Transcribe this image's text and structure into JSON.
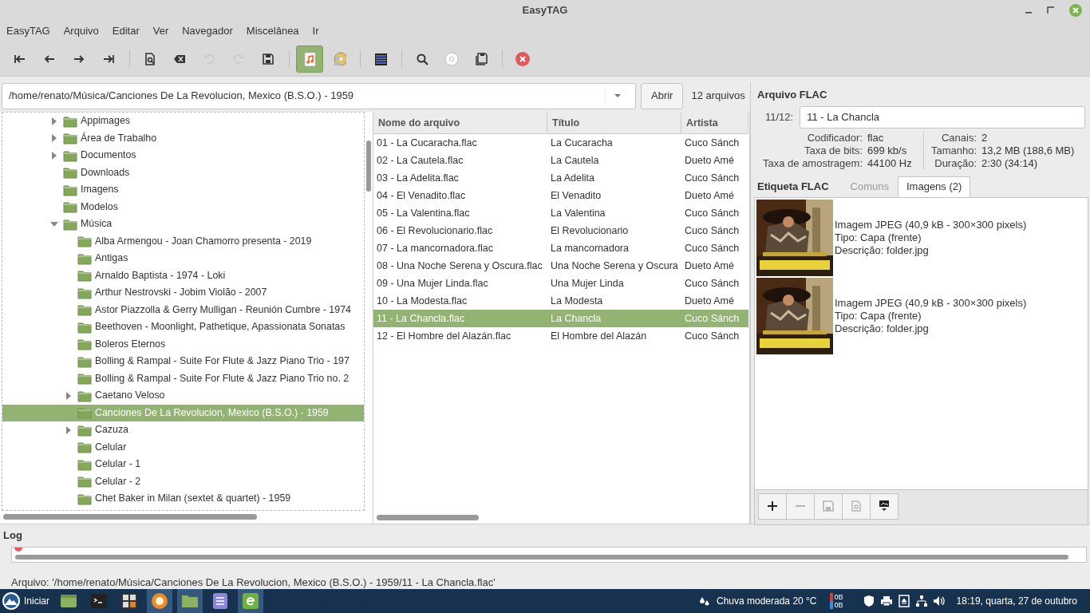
{
  "window": {
    "title": "EasyTAG"
  },
  "menu": [
    "EasyTAG",
    "Arquivo",
    "Editar",
    "Ver",
    "Navegador",
    "Miscelânea",
    "Ir"
  ],
  "toolbar": [
    {
      "kind": "first",
      "disabled": false
    },
    {
      "kind": "prev",
      "disabled": false
    },
    {
      "kind": "next",
      "disabled": false
    },
    {
      "kind": "last",
      "disabled": false
    },
    {
      "kind": "separator"
    },
    {
      "kind": "scan",
      "disabled": false
    },
    {
      "kind": "delete",
      "disabled": false
    },
    {
      "kind": "undo",
      "disabled": true
    },
    {
      "kind": "redo",
      "disabled": true
    },
    {
      "kind": "save",
      "disabled": false
    },
    {
      "kind": "separator"
    },
    {
      "kind": "note",
      "disabled": false,
      "pressed": true
    },
    {
      "kind": "artist",
      "disabled": false,
      "pressed": false
    },
    {
      "kind": "separator"
    },
    {
      "kind": "list",
      "disabled": false
    },
    {
      "kind": "separator"
    },
    {
      "kind": "search",
      "disabled": false
    },
    {
      "kind": "cd",
      "disabled": false
    },
    {
      "kind": "saveall",
      "disabled": false
    },
    {
      "kind": "separator"
    },
    {
      "kind": "quit",
      "disabled": false
    }
  ],
  "path": {
    "value": "/home/renato/Música/Canciones De La Revolucion, Mexico (B.S.O.) - 1959",
    "open_button": "Abrir",
    "count": "12 arquivos"
  },
  "tree": [
    {
      "label": "Appimages",
      "expandable": true,
      "expanded": false,
      "selected": false
    },
    {
      "label": "Área de Trabalho",
      "expandable": true,
      "expanded": false,
      "selected": false
    },
    {
      "label": "Documentos",
      "expandable": true,
      "expanded": false,
      "selected": false
    },
    {
      "label": "Downloads",
      "expandable": false,
      "selected": false
    },
    {
      "label": "Imagens",
      "expandable": false,
      "selected": false
    },
    {
      "label": "Modelos",
      "expandable": false,
      "selected": false
    },
    {
      "label": "Música",
      "expandable": true,
      "expanded": true,
      "selected": false,
      "children": [
        {
          "label": "Alba Armengou - Joan Chamorro presenta - 2019",
          "expandable": false,
          "selected": false
        },
        {
          "label": "Antigas",
          "expandable": false,
          "selected": false
        },
        {
          "label": "Arnaldo Baptista - 1974 - Loki",
          "expandable": false,
          "selected": false
        },
        {
          "label": "Arthur Nestrovski - Jobim Violão - 2007",
          "expandable": false,
          "selected": false
        },
        {
          "label": "Astor Piazzolla & Gerry Mulligan - Reunión Cumbre - 1974",
          "expandable": false,
          "selected": false
        },
        {
          "label": "Beethoven - Moonlight, Pathetique, Apassionata Sonatas",
          "expandable": false,
          "selected": false
        },
        {
          "label": "Boleros Eternos",
          "expandable": false,
          "selected": false
        },
        {
          "label": "Bolling & Rampal - Suite For Flute & Jazz Piano Trio - 197",
          "expandable": false,
          "selected": false
        },
        {
          "label": "Bolling & Rampal - Suite For Flute & Jazz Piano Trio no. 2",
          "expandable": false,
          "selected": false
        },
        {
          "label": "Caetano Veloso",
          "expandable": true,
          "expanded": false,
          "selected": false
        },
        {
          "label": "Canciones De La Revolucion, Mexico (B.S.O.) - 1959",
          "expandable": false,
          "selected": true
        },
        {
          "label": "Cazuza",
          "expandable": true,
          "expanded": false,
          "selected": false
        },
        {
          "label": "Celular",
          "expandable": false,
          "selected": false
        },
        {
          "label": "Celular - 1",
          "expandable": false,
          "selected": false
        },
        {
          "label": "Celular - 2",
          "expandable": false,
          "selected": false
        },
        {
          "label": "Chet Baker in Milan (sextet & quartet) - 1959",
          "expandable": false,
          "selected": false
        }
      ]
    }
  ],
  "files": {
    "columns": [
      "Nome do arquivo",
      "Título",
      "Artista"
    ],
    "rows": [
      {
        "cells": [
          "01 - La Cucaracha.flac",
          "La Cucaracha",
          "Cuco Sánch"
        ],
        "selected": false
      },
      {
        "cells": [
          "02 - La Cautela.flac",
          "La Cautela",
          "Dueto Amé"
        ],
        "selected": false
      },
      {
        "cells": [
          "03 - La Adelita.flac",
          "La Adelita",
          "Cuco Sánch"
        ],
        "selected": false
      },
      {
        "cells": [
          "04 - El Venadito.flac",
          "El Venadito",
          "Dueto Amé"
        ],
        "selected": false
      },
      {
        "cells": [
          "05 - La Valentina.flac",
          "La Valentina",
          "Cuco Sánch"
        ],
        "selected": false
      },
      {
        "cells": [
          "06 - El Revolucionario.flac",
          "El Revolucionario",
          "Cuco Sánch"
        ],
        "selected": false
      },
      {
        "cells": [
          "07 - La mancornadora.flac",
          "La mancornadora",
          "Cuco Sánch"
        ],
        "selected": false
      },
      {
        "cells": [
          "08 - Una Noche Serena y Oscura.flac",
          "Una Noche Serena y Oscura",
          "Dueto Amé"
        ],
        "selected": false
      },
      {
        "cells": [
          "09 - Una Mujer Linda.flac",
          "Una Mujer Linda",
          "Cuco Sánch"
        ],
        "selected": false
      },
      {
        "cells": [
          "10 - La Modesta.flac",
          "La Modesta",
          "Dueto Amé"
        ],
        "selected": false
      },
      {
        "cells": [
          "11 - La Chancla.flac",
          "La Chancla",
          "Cuco Sánch"
        ],
        "selected": true
      },
      {
        "cells": [
          "12 - El Hombre del Alazán.flac",
          "El Hombre del Alazán",
          "Cuco Sánch"
        ],
        "selected": false
      }
    ]
  },
  "info": {
    "heading": "Arquivo FLAC",
    "position": "11/12:",
    "name": "11 - La Chancla",
    "left": [
      {
        "label": "Codificador:",
        "value": "flac"
      },
      {
        "label": "Taxa de bits:",
        "value": "699 kb/s"
      },
      {
        "label": "Taxa de amostragem:",
        "value": "44100 Hz"
      }
    ],
    "right": [
      {
        "label": "Canais:",
        "value": "2"
      },
      {
        "label": "Tamanho:",
        "value": "13,2 MB (188,6 MB)"
      },
      {
        "label": "Duração:",
        "value": "2:30 (34:14)"
      }
    ]
  },
  "tag": {
    "label": "Etiqueta FLAC",
    "tabs": [
      {
        "label": "Comuns",
        "selected": false
      },
      {
        "label": "Imagens (2)",
        "selected": true
      }
    ]
  },
  "images": [
    {
      "kind": "picture",
      "lines": [
        "Imagem JPEG (40,9 kB - 300×300 pixels)",
        "Tipo: Capa (frente)",
        "Descrição: folder.jpg"
      ]
    },
    {
      "kind": "picture",
      "lines": [
        "Imagem JPEG (40,9 kB - 300×300 pixels)",
        "Tipo: Capa (frente)",
        "Descrição: folder.jpg"
      ]
    }
  ],
  "image_buttons": [
    {
      "kind": "add",
      "disabled": false
    },
    {
      "kind": "remove",
      "disabled": true
    },
    {
      "kind": "save",
      "disabled": true
    },
    {
      "kind": "properties",
      "disabled": true
    },
    {
      "kind": "menu",
      "disabled": false
    }
  ],
  "log": {
    "title": "Log",
    "entries": [
      {
        "kind": "error"
      }
    ]
  },
  "status": "Arquivo: '/home/renato/Música/Canciones De La Revolucion, Mexico (B.S.O.) - 1959/11 - La Chancla.flac'",
  "taskbar": {
    "start": "Iniciar",
    "apps": [
      {
        "kind": "files",
        "active": false
      },
      {
        "kind": "terminal",
        "active": false
      },
      {
        "kind": "calculator",
        "active": false
      },
      {
        "kind": "browser",
        "active": true
      },
      {
        "kind": "folder",
        "active": true
      },
      {
        "kind": "notes",
        "active": false
      },
      {
        "kind": "easytag",
        "active": true
      }
    ],
    "weather": "Chuva moderada 20 °C",
    "net_up": "0B",
    "net_down": "0B",
    "tray": [
      {
        "kind": "shield"
      },
      {
        "kind": "printer"
      },
      {
        "kind": "eject"
      },
      {
        "kind": "network"
      },
      {
        "kind": "volume"
      }
    ],
    "clock": "18:19, quarta, 27 de outubro"
  }
}
